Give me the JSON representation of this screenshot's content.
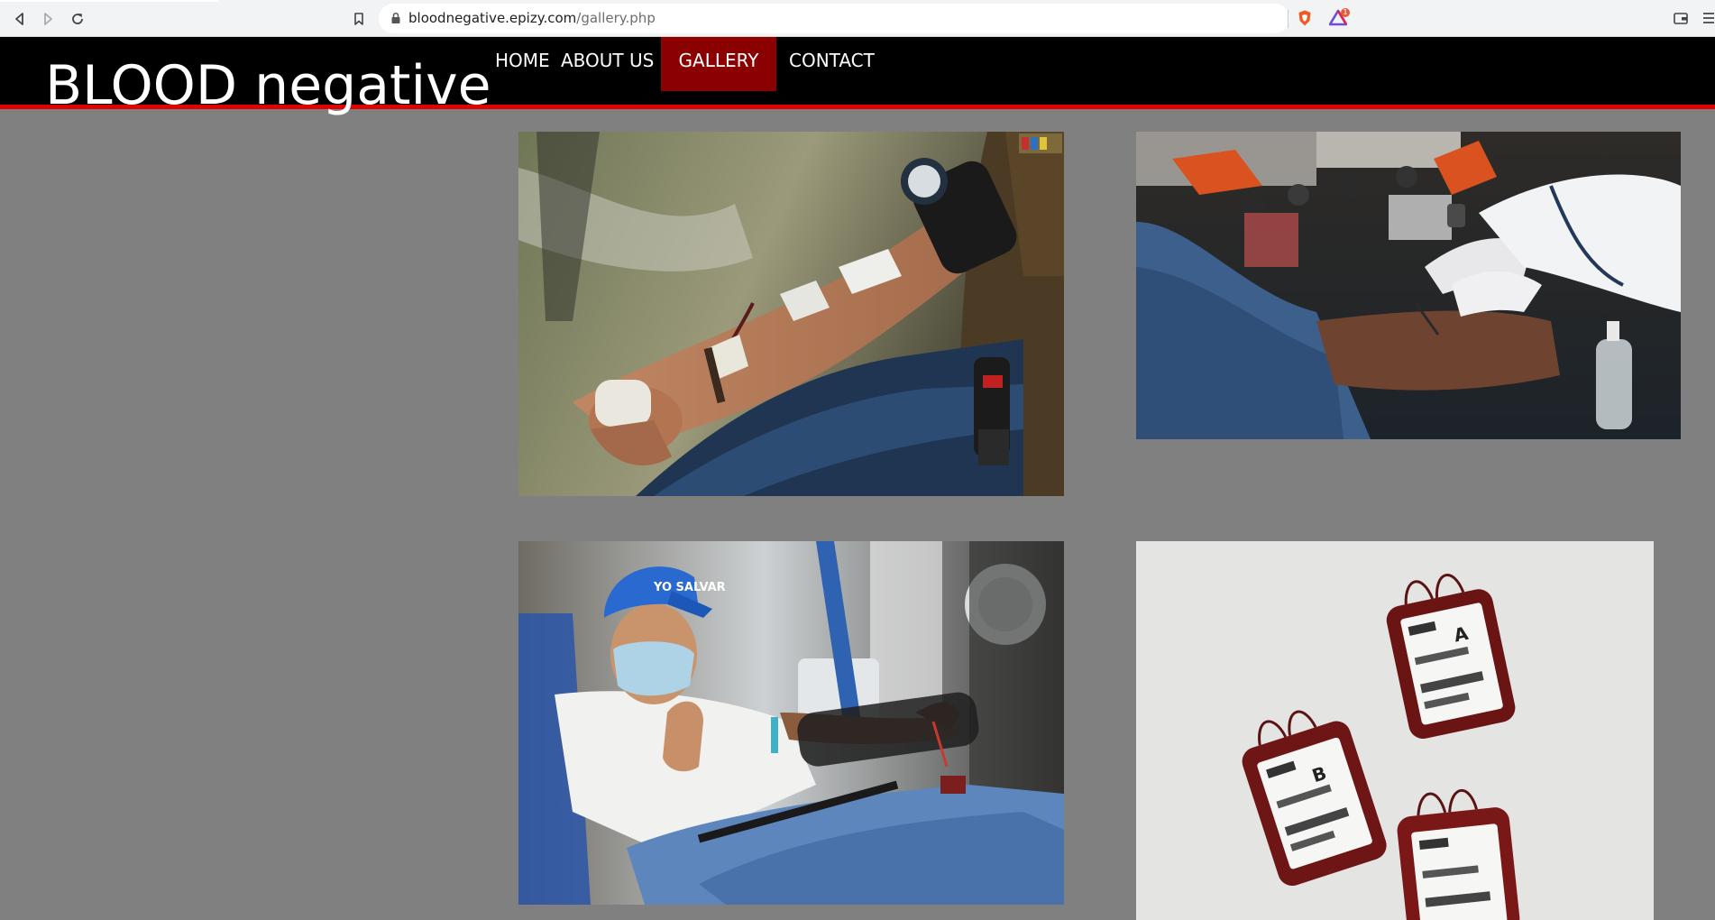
{
  "browser": {
    "url_host": "bloodnegative.epizy.com",
    "url_path": "/gallery.php",
    "icons": [
      "back-icon",
      "forward-icon",
      "reload-icon",
      "bookmark-icon",
      "lock-icon",
      "brave-shield-icon",
      "brave-rewards-icon",
      "wallet-icon",
      "menu-icon"
    ],
    "rewards_badge": "1"
  },
  "site": {
    "brand": "BLOOD negative",
    "nav": [
      {
        "label": "HOME",
        "active": false
      },
      {
        "label": "ABOUT US",
        "active": false
      },
      {
        "label": "GALLERY",
        "active": true
      },
      {
        "label": "CONTACT",
        "active": false
      }
    ],
    "colors": {
      "header_bg": "#000000",
      "accent_line": "#e00000",
      "active_tab": "#8b0000",
      "page_bg": "#808080"
    }
  },
  "gallery": {
    "images": [
      {
        "name": "donor-arm-photo"
      },
      {
        "name": "nurse-drawing-blood-photo"
      },
      {
        "name": "masked-donor-thumbs-up-photo"
      },
      {
        "name": "blood-bags-photo"
      }
    ],
    "labels": {
      "cap_text": "YO SALVAR",
      "bag_a": "A",
      "bag_b": "B"
    }
  }
}
